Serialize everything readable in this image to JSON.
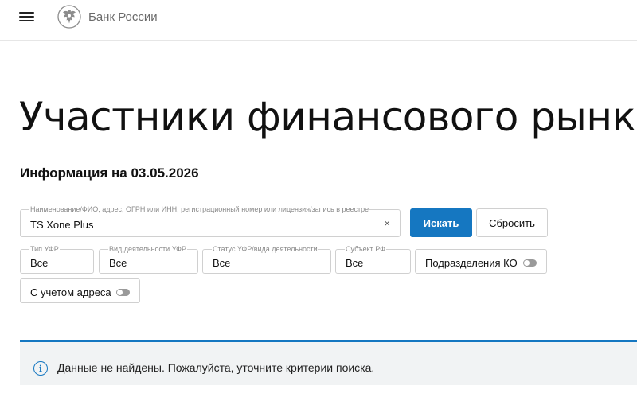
{
  "header": {
    "logo_text": "Банк России",
    "icons": [
      "hamburger-menu-icon",
      "eagle-emblem-icon"
    ]
  },
  "page": {
    "title": "Участники финансового рынка",
    "info_date": "Информация на 03.05.2026"
  },
  "search": {
    "label": "Наименование/ФИО, адрес, ОГРН или ИНН, регистрационный номер или лицензия/запись в реестре",
    "value": "TS Xone Plus",
    "clear_symbol": "×",
    "submit_label": "Искать",
    "reset_label": "Сбросить"
  },
  "filters": [
    {
      "label": "Тип УФР",
      "value": "Все"
    },
    {
      "label": "Вид деятельности УФР",
      "value": "Все"
    },
    {
      "label": "Статус УФР/вида деятельности",
      "value": "Все"
    },
    {
      "label": "Субъект РФ",
      "value": "Все"
    }
  ],
  "toggles": [
    {
      "label": "Подразделения КО",
      "enabled": false
    },
    {
      "label": "С учетом адреса",
      "enabled": false
    }
  ],
  "alert": {
    "icon": "info-icon",
    "icon_glyph": "i",
    "text": "Данные не найдены. Пожалуйста, уточните критерии поиска."
  },
  "colors": {
    "accent": "#1577c1",
    "alert_bg": "#f1f3f4",
    "border": "#d0d0d0"
  }
}
